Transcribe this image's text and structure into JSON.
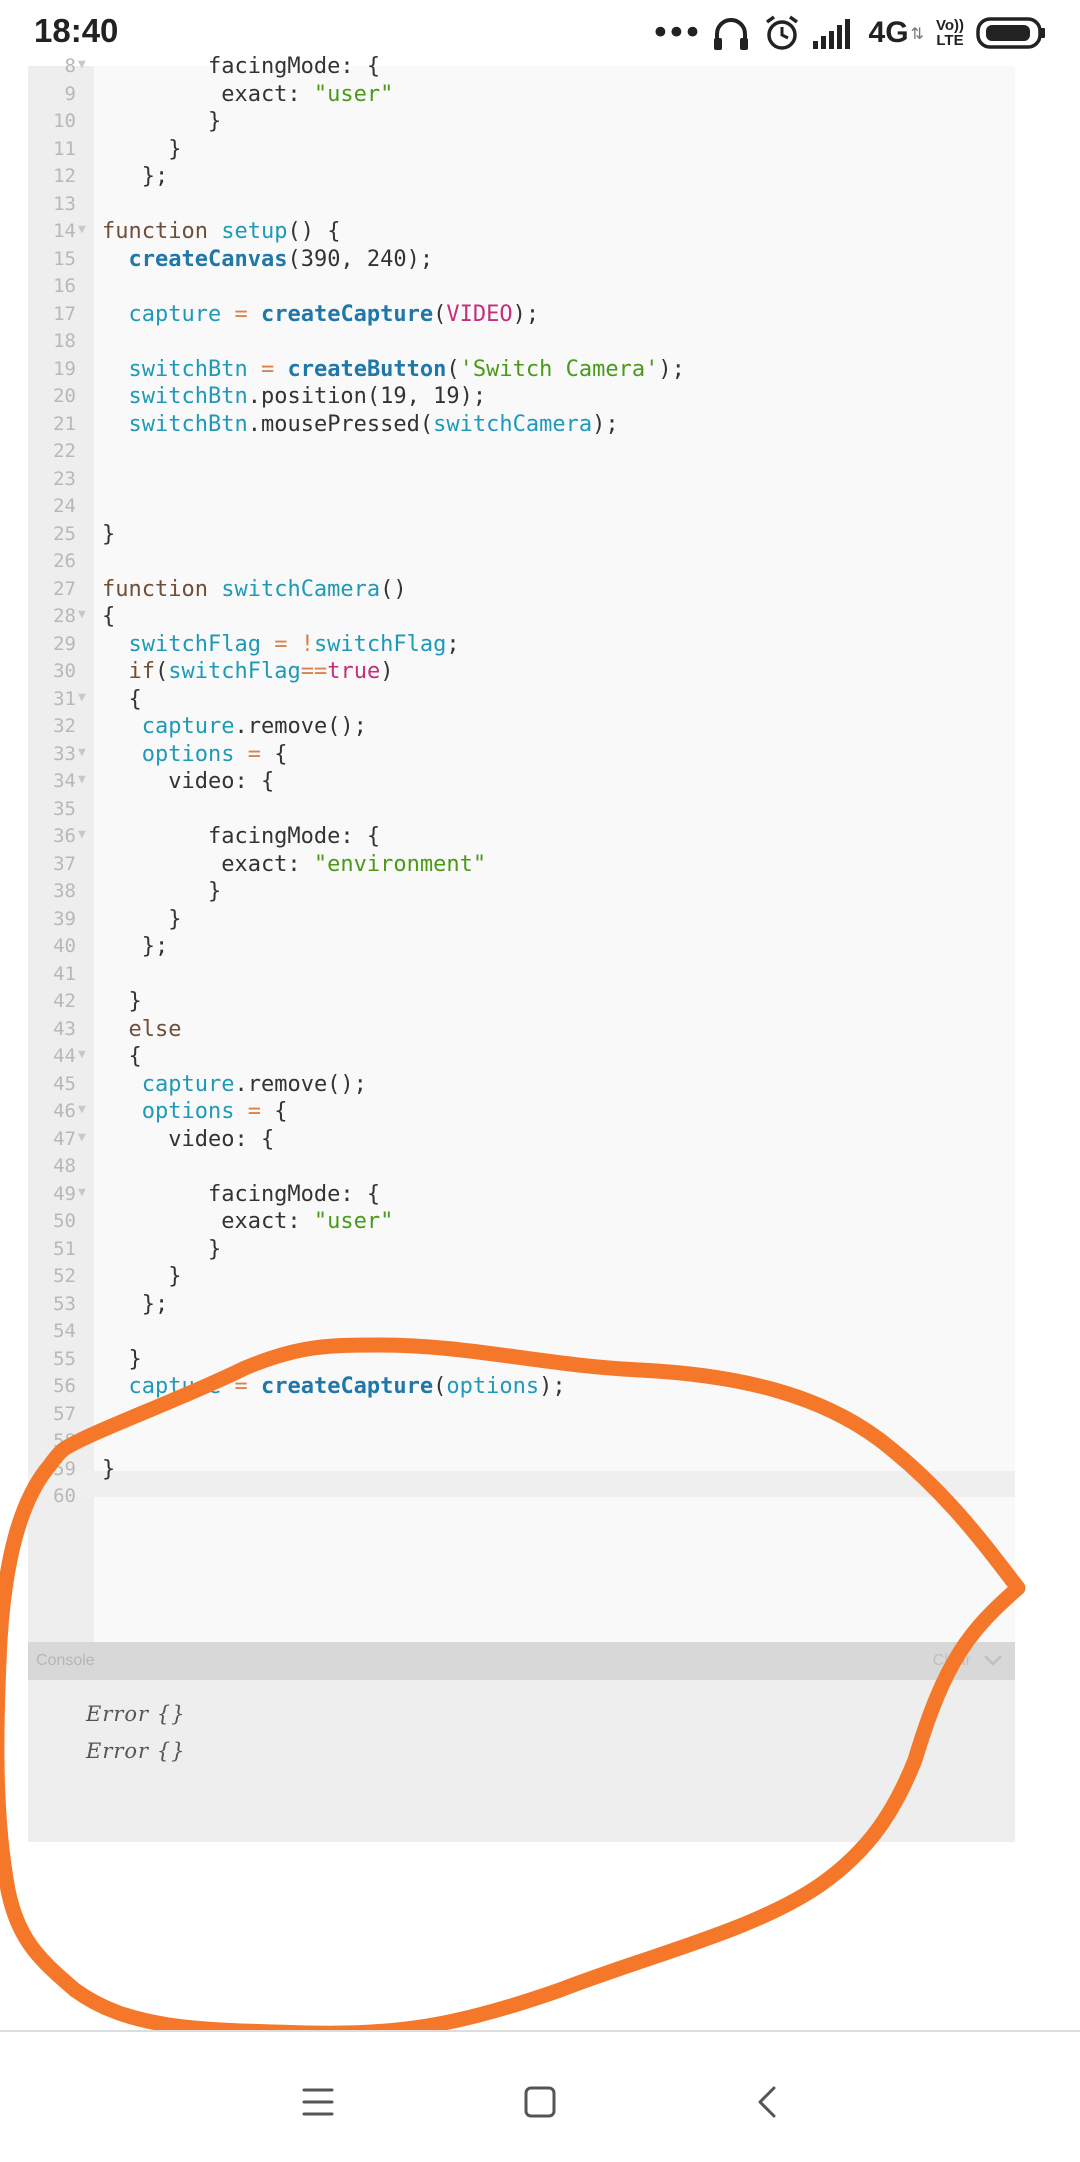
{
  "status_bar": {
    "time": "18:40",
    "network": "4G",
    "volte_top": "Vo))",
    "volte_bottom": "LTE",
    "icons": [
      "more-dots-icon",
      "headphones-icon",
      "alarm-icon",
      "signal-icon",
      "battery-icon"
    ]
  },
  "editor": {
    "lines": [
      {
        "n": "8",
        "fold": true
      },
      {
        "n": "9"
      },
      {
        "n": "10"
      },
      {
        "n": "11"
      },
      {
        "n": "12"
      },
      {
        "n": "13"
      },
      {
        "n": "14",
        "fold": true
      },
      {
        "n": "15"
      },
      {
        "n": "16"
      },
      {
        "n": "17"
      },
      {
        "n": "18"
      },
      {
        "n": "19"
      },
      {
        "n": "20"
      },
      {
        "n": "21"
      },
      {
        "n": "22"
      },
      {
        "n": "23"
      },
      {
        "n": "24"
      },
      {
        "n": "25"
      },
      {
        "n": "26"
      },
      {
        "n": "27"
      },
      {
        "n": "28",
        "fold": true
      },
      {
        "n": "29"
      },
      {
        "n": "30"
      },
      {
        "n": "31",
        "fold": true
      },
      {
        "n": "32"
      },
      {
        "n": "33",
        "fold": true
      },
      {
        "n": "34",
        "fold": true
      },
      {
        "n": "35"
      },
      {
        "n": "36",
        "fold": true
      },
      {
        "n": "37"
      },
      {
        "n": "38"
      },
      {
        "n": "39"
      },
      {
        "n": "40"
      },
      {
        "n": "41"
      },
      {
        "n": "42"
      },
      {
        "n": "43"
      },
      {
        "n": "44",
        "fold": true
      },
      {
        "n": "45"
      },
      {
        "n": "46",
        "fold": true
      },
      {
        "n": "47",
        "fold": true
      },
      {
        "n": "48"
      },
      {
        "n": "49",
        "fold": true
      },
      {
        "n": "50"
      },
      {
        "n": "51"
      },
      {
        "n": "52"
      },
      {
        "n": "53"
      },
      {
        "n": "54"
      },
      {
        "n": "55"
      },
      {
        "n": "56"
      },
      {
        "n": "57"
      },
      {
        "n": "58"
      },
      {
        "n": "59"
      },
      {
        "n": "60"
      }
    ],
    "code": [
      [
        [
          "",
          "        facingMode: {"
        ]
      ],
      [
        [
          "",
          "         exact: "
        ],
        [
          "str",
          "\"user\""
        ]
      ],
      [
        [
          "",
          "        }"
        ]
      ],
      [
        [
          "",
          "     }"
        ]
      ],
      [
        [
          "",
          "   };"
        ]
      ],
      [],
      [
        [
          "kw",
          "function "
        ],
        [
          "var",
          "setup"
        ],
        [
          "",
          "() {"
        ]
      ],
      [
        [
          "",
          "  "
        ],
        [
          "fn",
          "createCanvas"
        ],
        [
          "",
          "(390, 240);"
        ]
      ],
      [],
      [
        [
          "",
          "  "
        ],
        [
          "var",
          "capture"
        ],
        [
          "op",
          " = "
        ],
        [
          "fn",
          "createCapture"
        ],
        [
          "",
          "("
        ],
        [
          "const",
          "VIDEO"
        ],
        [
          "",
          ");"
        ]
      ],
      [],
      [
        [
          "",
          "  "
        ],
        [
          "var",
          "switchBtn"
        ],
        [
          "op",
          " = "
        ],
        [
          "fn",
          "createButton"
        ],
        [
          "",
          "("
        ],
        [
          "str",
          "'Switch Camera'"
        ],
        [
          "",
          ");"
        ]
      ],
      [
        [
          "",
          "  "
        ],
        [
          "var",
          "switchBtn"
        ],
        [
          "",
          ".position(19, 19);"
        ]
      ],
      [
        [
          "",
          "  "
        ],
        [
          "var",
          "switchBtn"
        ],
        [
          "",
          ".mousePressed("
        ],
        [
          "var",
          "switchCamera"
        ],
        [
          "",
          ");"
        ]
      ],
      [],
      [],
      [],
      [
        [
          "",
          "}"
        ]
      ],
      [],
      [
        [
          "kw",
          "function "
        ],
        [
          "var",
          "switchCamera"
        ],
        [
          "",
          "()"
        ]
      ],
      [
        [
          "",
          "{"
        ]
      ],
      [
        [
          "",
          "  "
        ],
        [
          "var",
          "switchFlag"
        ],
        [
          "op",
          " = !"
        ],
        [
          "var",
          "switchFlag"
        ],
        [
          "",
          ";"
        ]
      ],
      [
        [
          "",
          "  "
        ],
        [
          "kw",
          "if"
        ],
        [
          "",
          "("
        ],
        [
          "var",
          "switchFlag"
        ],
        [
          "op",
          "=="
        ],
        [
          "const",
          "true"
        ],
        [
          "",
          ")"
        ]
      ],
      [
        [
          "",
          "  {"
        ]
      ],
      [
        [
          "",
          "   "
        ],
        [
          "var",
          "capture"
        ],
        [
          "",
          ".remove();"
        ]
      ],
      [
        [
          "",
          "   "
        ],
        [
          "var",
          "options"
        ],
        [
          "op",
          " = "
        ],
        [
          "",
          "{"
        ]
      ],
      [
        [
          "",
          "     video: {"
        ]
      ],
      [],
      [
        [
          "",
          "        facingMode: {"
        ]
      ],
      [
        [
          "",
          "         exact: "
        ],
        [
          "str",
          "\"environment\""
        ]
      ],
      [
        [
          "",
          "        }"
        ]
      ],
      [
        [
          "",
          "     }"
        ]
      ],
      [
        [
          "",
          "   };"
        ]
      ],
      [],
      [
        [
          "",
          "  }"
        ]
      ],
      [
        [
          "",
          "  "
        ],
        [
          "kw",
          "else"
        ]
      ],
      [
        [
          "",
          "  {"
        ]
      ],
      [
        [
          "",
          "   "
        ],
        [
          "var",
          "capture"
        ],
        [
          "",
          ".remove();"
        ]
      ],
      [
        [
          "",
          "   "
        ],
        [
          "var",
          "options"
        ],
        [
          "op",
          " = "
        ],
        [
          "",
          "{"
        ]
      ],
      [
        [
          "",
          "     video: {"
        ]
      ],
      [],
      [
        [
          "",
          "        facingMode: {"
        ]
      ],
      [
        [
          "",
          "         exact: "
        ],
        [
          "str",
          "\"user\""
        ]
      ],
      [
        [
          "",
          "        }"
        ]
      ],
      [
        [
          "",
          "     }"
        ]
      ],
      [
        [
          "",
          "   };"
        ]
      ],
      [],
      [
        [
          "",
          "  }"
        ]
      ],
      [
        [
          "",
          "  "
        ],
        [
          "var",
          "capture"
        ],
        [
          "op",
          " = "
        ],
        [
          "fn",
          "createCapture"
        ],
        [
          "",
          "("
        ],
        [
          "var",
          "options"
        ],
        [
          "",
          ");"
        ]
      ],
      [],
      [],
      [
        [
          "",
          "}"
        ]
      ],
      []
    ]
  },
  "console": {
    "title": "Console",
    "clear_label": "Clear",
    "messages": [
      "Error {}",
      "Error {}"
    ]
  },
  "annotation": {
    "color": "#f5782a"
  },
  "navbar": {
    "icons": [
      "menu-icon",
      "home-square-icon",
      "back-chevron-icon"
    ]
  }
}
